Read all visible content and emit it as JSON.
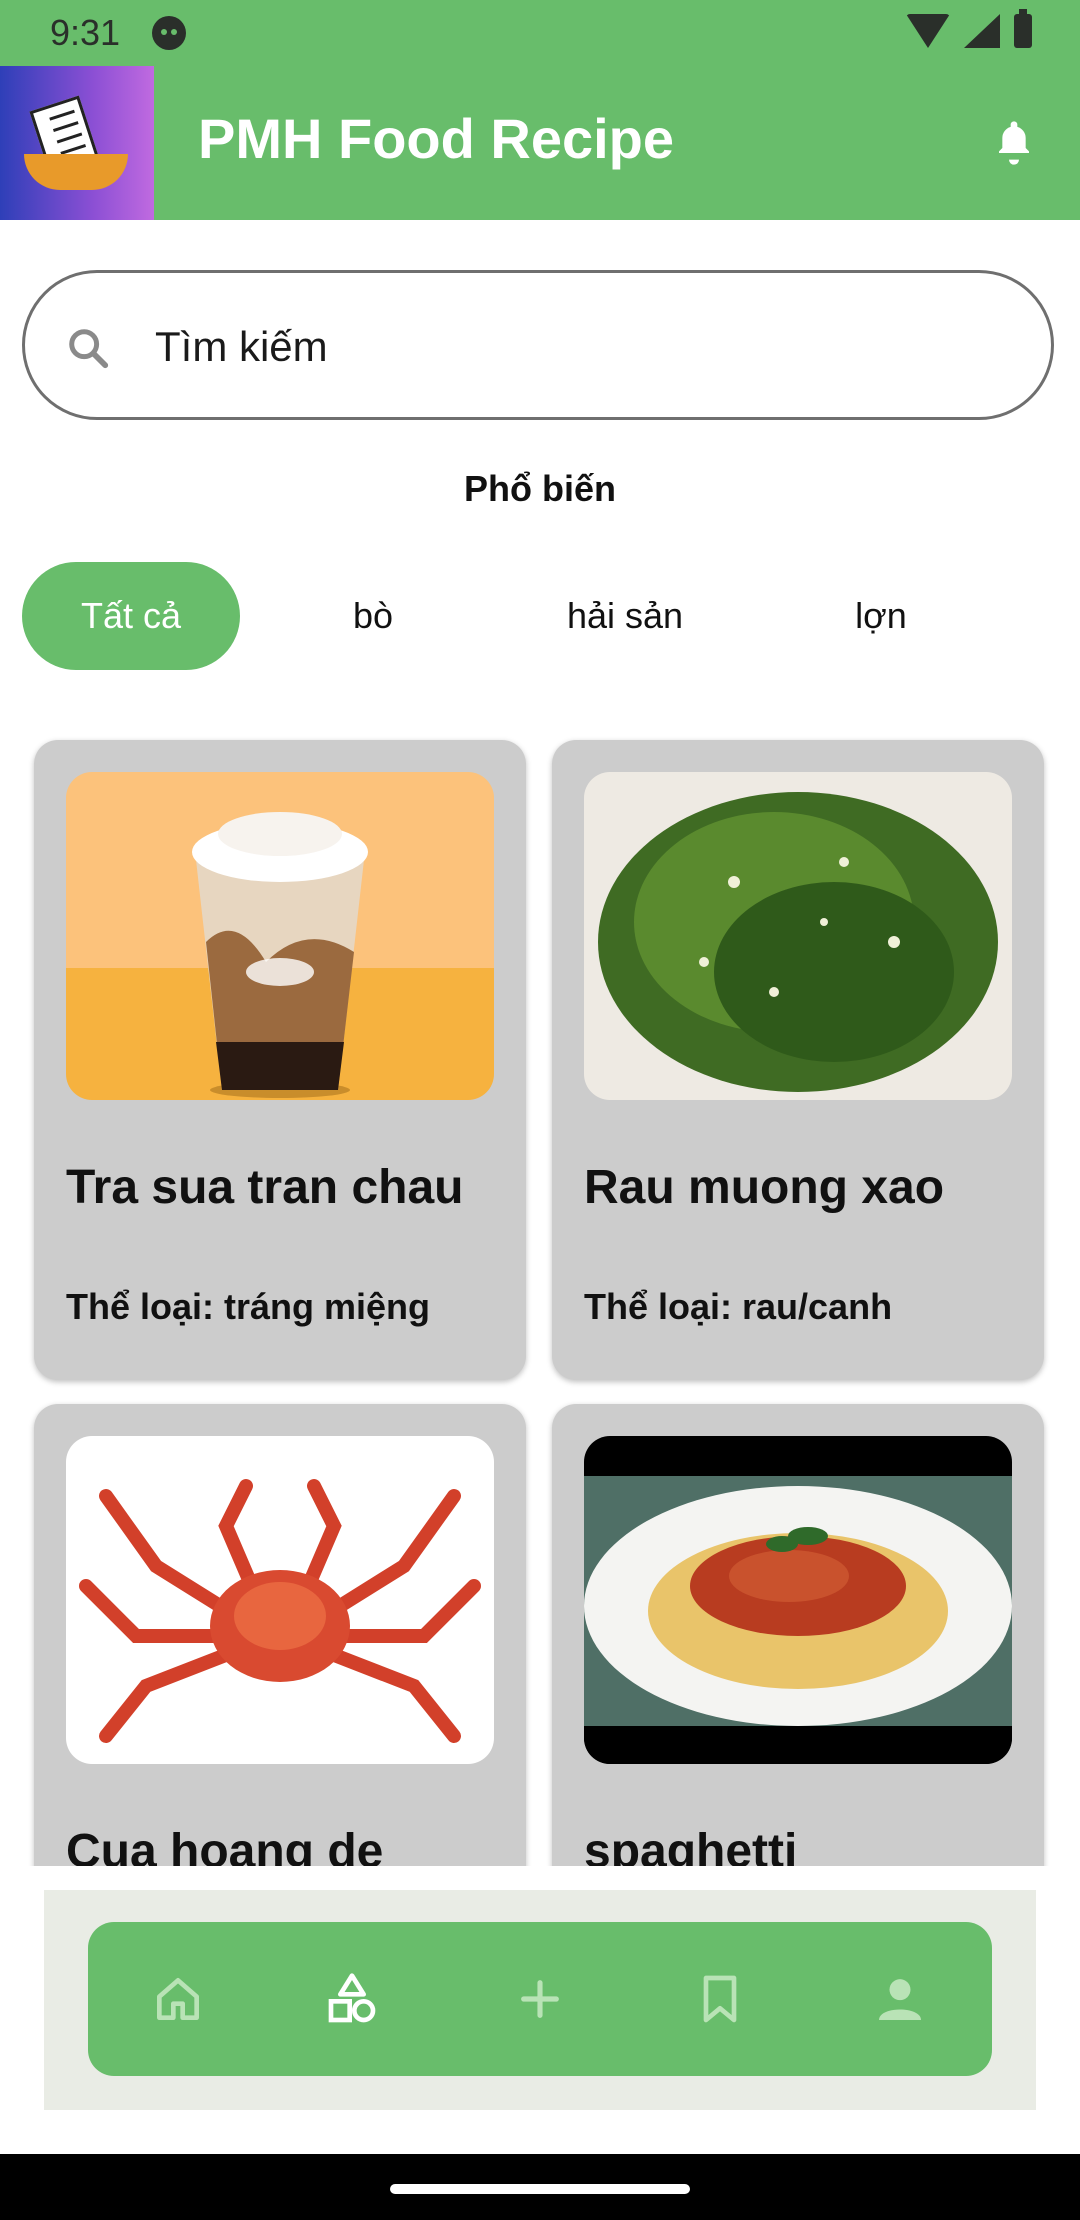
{
  "status_bar": {
    "time": "9:31"
  },
  "app_bar": {
    "title": "PMH Food Recipe"
  },
  "search": {
    "placeholder": "Tìm kiếm"
  },
  "section": {
    "title": "Phổ biến"
  },
  "categories": [
    {
      "label": "Tất cả",
      "active": true
    },
    {
      "label": "bò",
      "active": false
    },
    {
      "label": "hải sản",
      "active": false
    },
    {
      "label": "lợn",
      "active": false
    }
  ],
  "recipes": [
    {
      "title": "Tra sua tran chau",
      "category": "Thể loại: tráng miệng"
    },
    {
      "title": "Rau muong xao",
      "category": "Thể loại: rau/canh"
    },
    {
      "title": "Cua hoang de",
      "category": ""
    },
    {
      "title": "spaghetti",
      "category": ""
    }
  ],
  "bottom_nav": [
    {
      "icon": "home-icon",
      "active": false
    },
    {
      "icon": "categories-icon",
      "active": true
    },
    {
      "icon": "add-icon",
      "active": false
    },
    {
      "icon": "bookmark-icon",
      "active": false
    },
    {
      "icon": "profile-icon",
      "active": false
    }
  ],
  "colors": {
    "primary": "#68bd6b",
    "card": "#cccccc",
    "nav_bg": "#e9ece5"
  }
}
